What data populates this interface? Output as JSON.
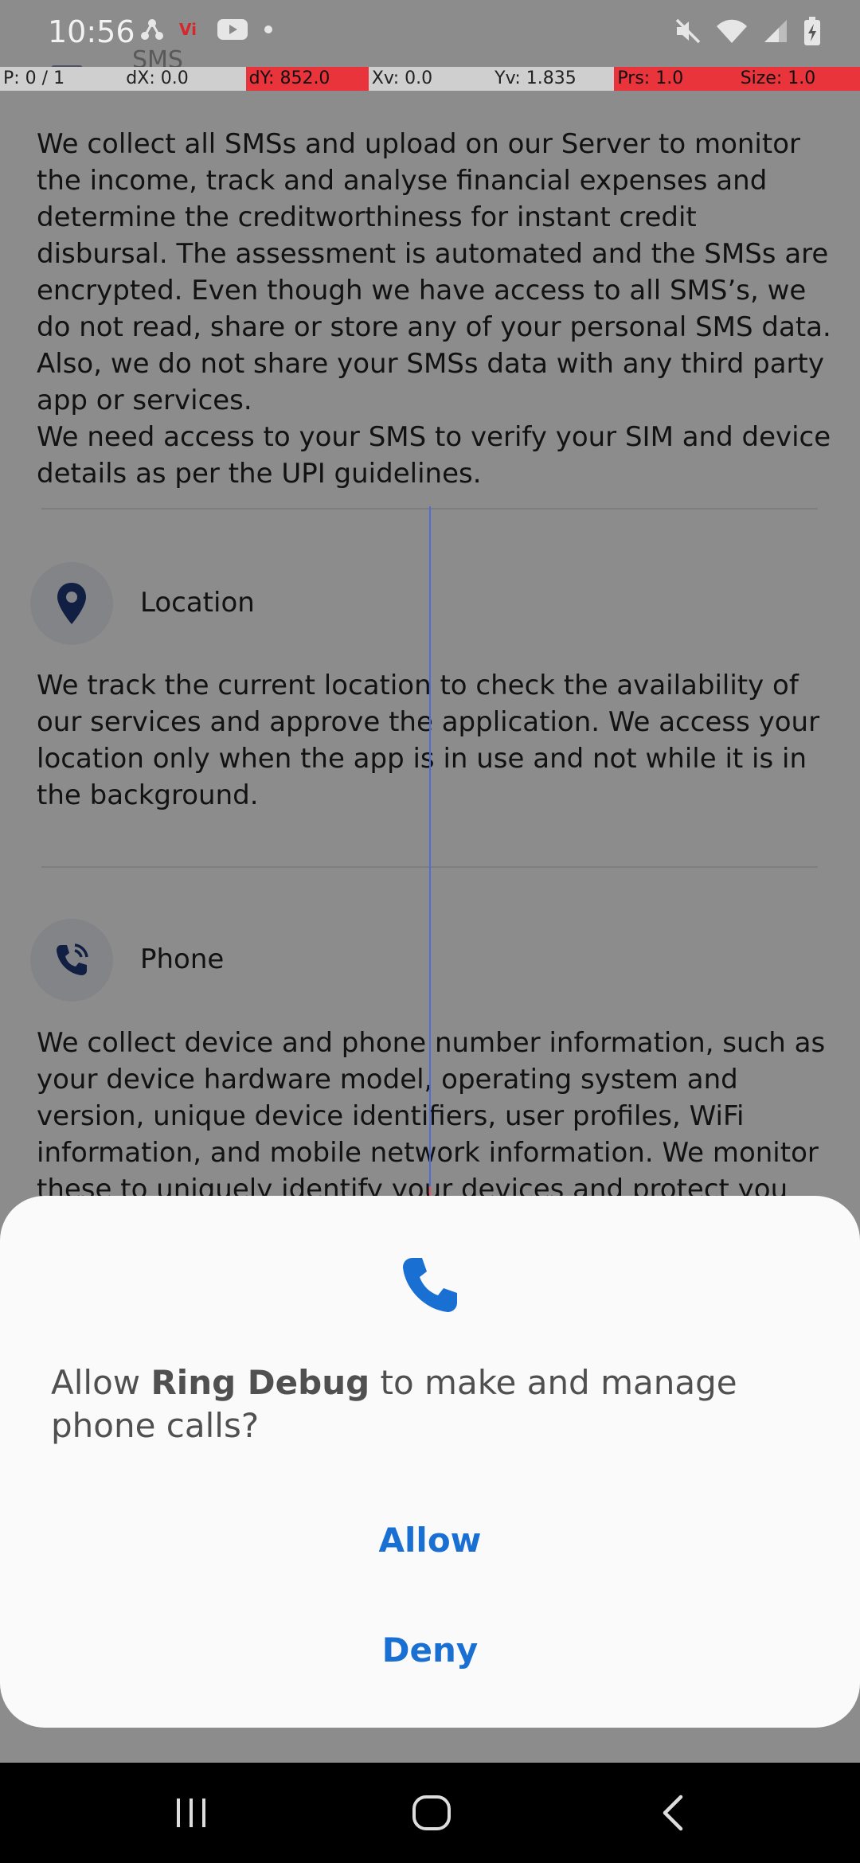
{
  "status_bar": {
    "time": "10:56",
    "left_icons": [
      "share-nodes-icon",
      "vi-network-icon",
      "youtube-icon",
      "dot-icon"
    ],
    "right_icons": [
      "mute-icon",
      "wifi-icon",
      "signal-icon",
      "battery-charging-icon"
    ]
  },
  "debug_bar": {
    "pointers": "P: 0 / 1",
    "dx": "dX: 0.0",
    "dy": "dY: 852.0",
    "xv": "Xv: 0.0",
    "yv": "Yv: 1.835",
    "prs": "Prs: 1.0",
    "size": "Size: 1.0"
  },
  "page": {
    "sms": {
      "ghost_title": "SMS",
      "body": "We collect all SMSs and upload on our Server to monitor the income, track and analyse financial expenses and determine the creditworthiness for instant credit disbursal. The assessment is automated and the SMSs are encrypted. Even though we have access to all SMS’s, we do not read, share or store any of your personal SMS data. Also, we do not share your SMSs data with any third party app or services.\nWe need access to your SMS to verify your SIM and device details as per the UPI guidelines."
    },
    "location": {
      "title": "Location",
      "body": "We track the current location to check the availability of our services and approve the application. We access your location only when the app is in use and not while it is in the background."
    },
    "phone": {
      "title": "Phone",
      "body": "We collect device and phone number information, such as your device hardware model, operating system and version, unique device identifiers, user profiles, WiFi information, and mobile network information. We monitor these to uniquely identify your devices and protect you from fraud by"
    }
  },
  "dialog": {
    "prefix": "Allow ",
    "app_name": "Ring Debug",
    "suffix": " to make and manage phone calls?",
    "allow_label": "Allow",
    "deny_label": "Deny",
    "icon": "phone-icon"
  },
  "nav_bar": {
    "buttons": [
      "recent-apps-icon",
      "home-icon",
      "back-icon"
    ]
  },
  "colors": {
    "accent": "#1a6fd3",
    "icon_navy": "#1f3a7a",
    "debug_red": "#e8343a",
    "debug_gray": "#cfcfcf"
  }
}
